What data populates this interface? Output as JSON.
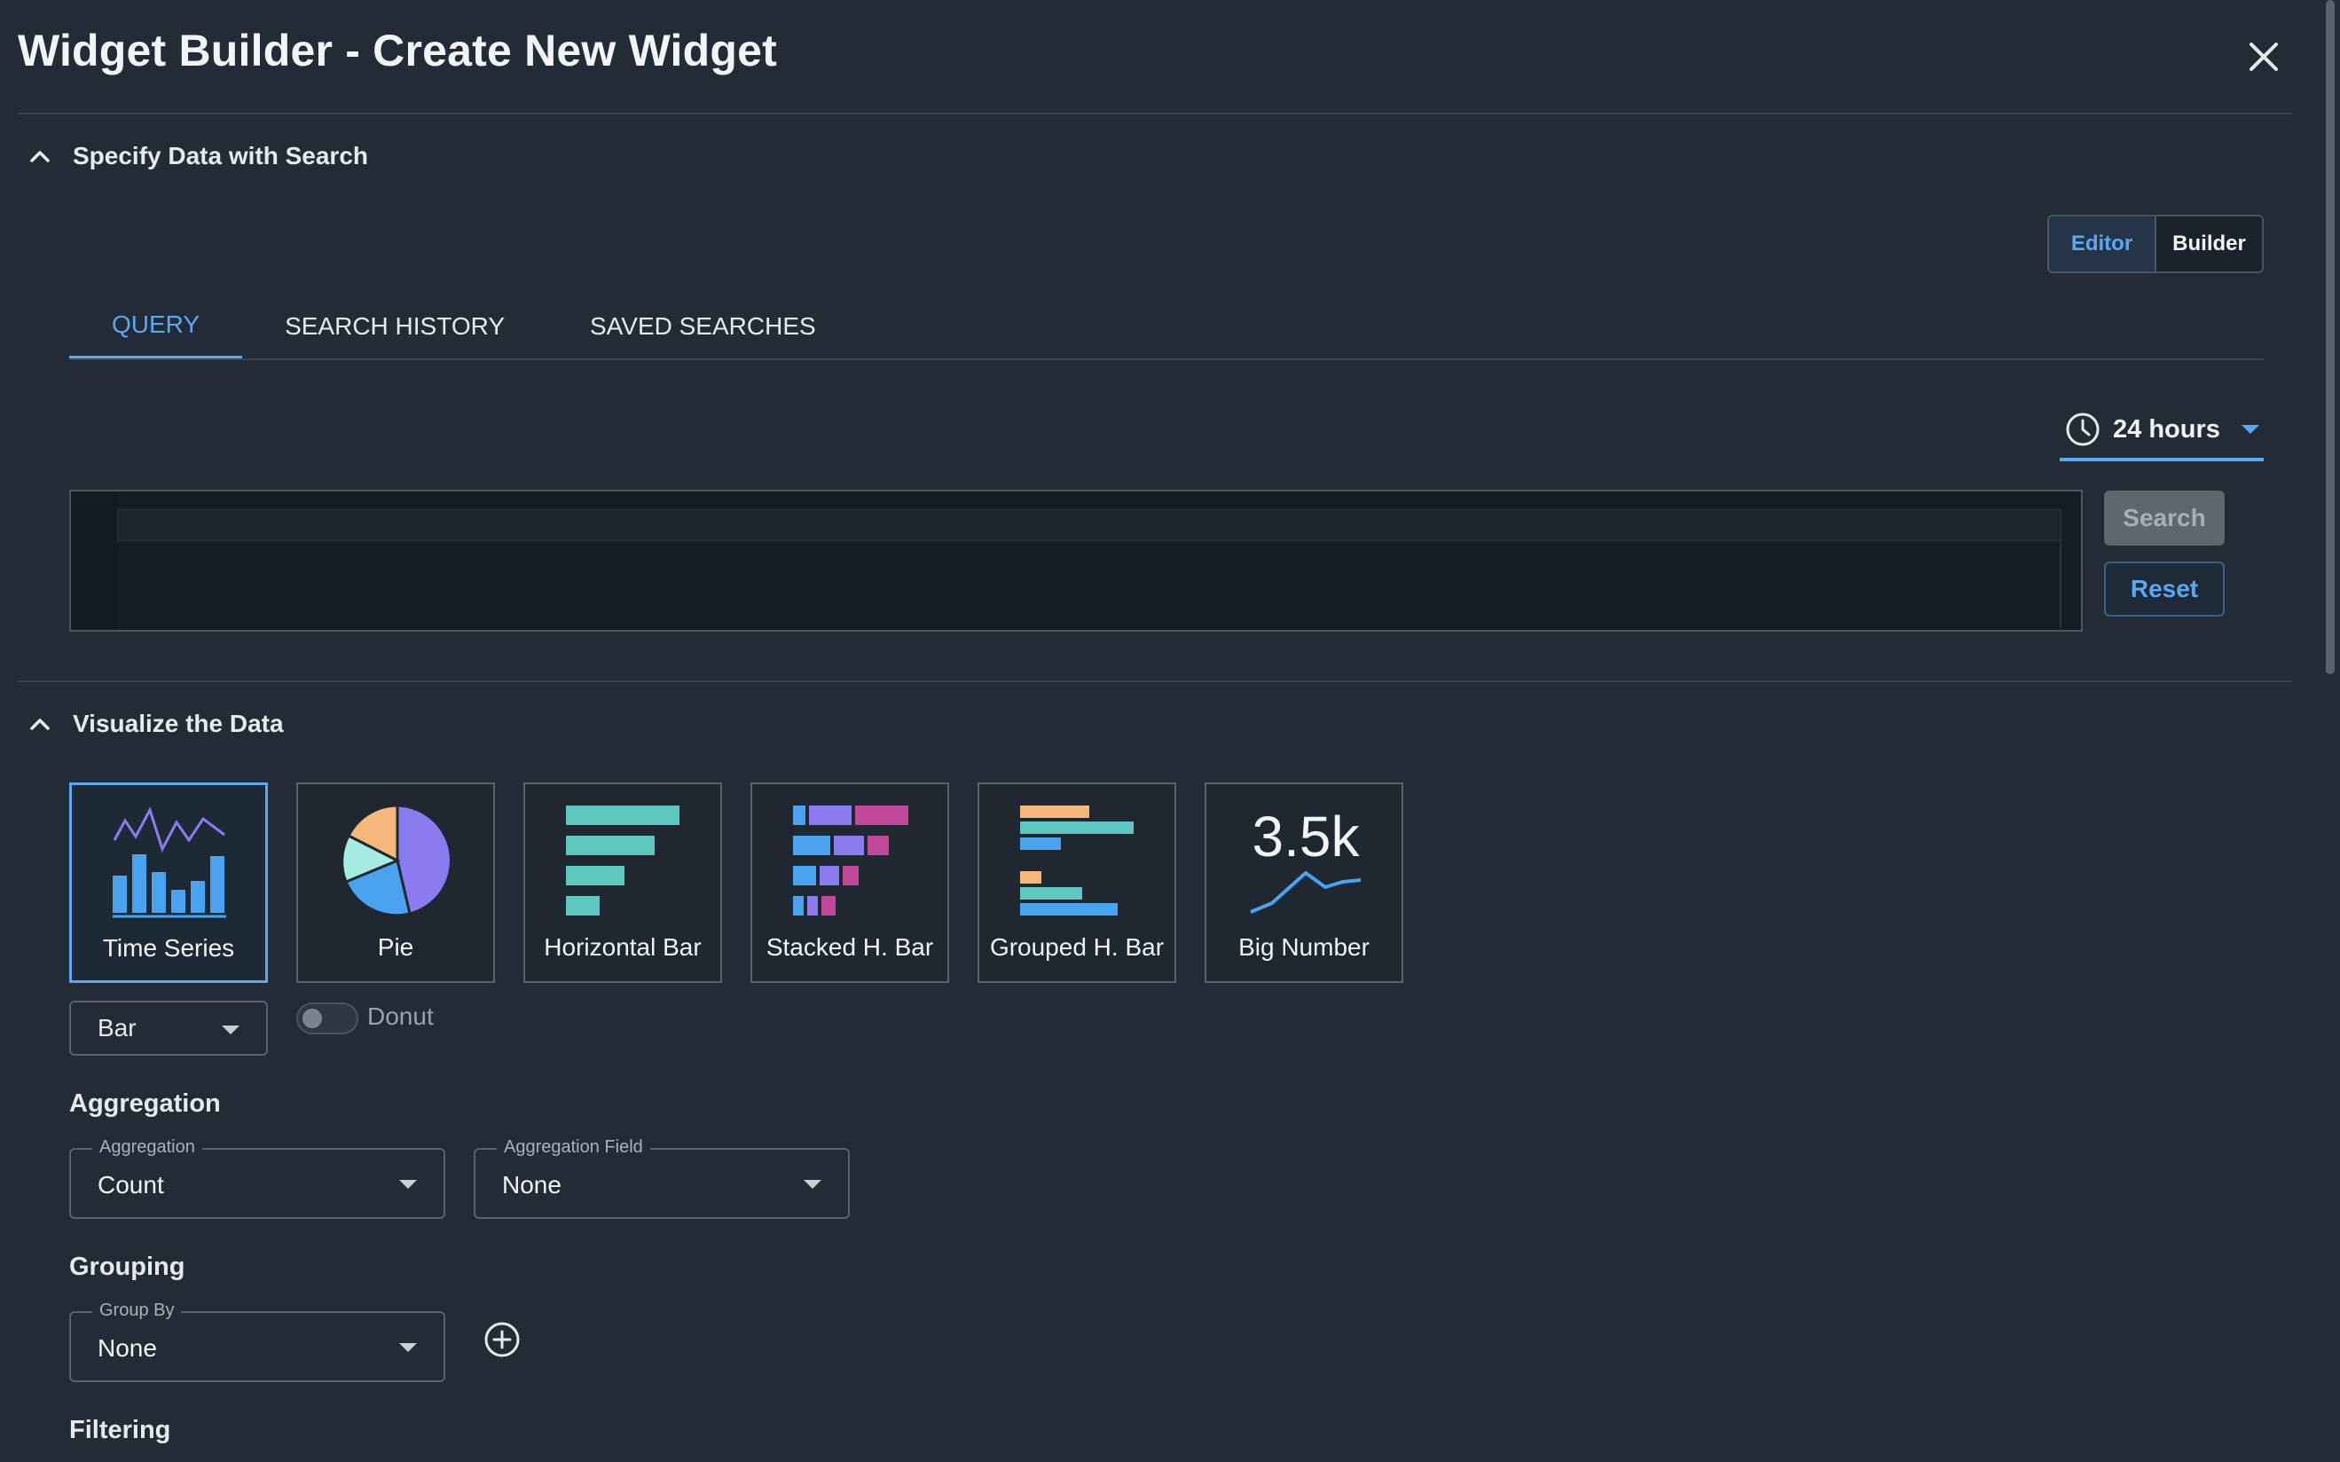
{
  "dialog": {
    "title": "Widget Builder - Create New Widget",
    "close_icon": "close-icon"
  },
  "search_section": {
    "header": "Specify Data with Search",
    "mode_toggle": {
      "editor": "Editor",
      "builder": "Builder",
      "selected": "Editor"
    },
    "tabs": [
      {
        "label": "QUERY",
        "active": true
      },
      {
        "label": "SEARCH HISTORY",
        "active": false
      },
      {
        "label": "SAVED SEARCHES",
        "active": false
      }
    ],
    "time_range": {
      "label": "24 hours",
      "icon": "clock-icon"
    },
    "query_value": "",
    "search_button": "Search",
    "reset_button": "Reset"
  },
  "visualize_section": {
    "header": "Visualize the Data",
    "chart_types": [
      {
        "label": "Time Series",
        "icon": "time-series-chart-icon",
        "selected": true
      },
      {
        "label": "Pie",
        "icon": "pie-chart-icon",
        "selected": false
      },
      {
        "label": "Horizontal Bar",
        "icon": "horizontal-bar-chart-icon",
        "selected": false
      },
      {
        "label": "Stacked H. Bar",
        "icon": "stacked-horizontal-bar-icon",
        "selected": false
      },
      {
        "label": "Grouped H. Bar",
        "icon": "grouped-horizontal-bar-icon",
        "selected": false
      },
      {
        "label": "Big Number",
        "icon": "big-number-icon",
        "selected": false,
        "preview_value": "3.5k"
      }
    ],
    "series_style": {
      "value": "Bar"
    },
    "donut_toggle": {
      "label": "Donut",
      "on": false
    },
    "aggregation": {
      "heading": "Aggregation",
      "aggregation_field": {
        "label": "Aggregation",
        "value": "Count"
      },
      "aggregation_field_select": {
        "label": "Aggregation Field",
        "value": "None"
      }
    },
    "grouping": {
      "heading": "Grouping",
      "group_by": {
        "label": "Group By",
        "value": "None"
      }
    },
    "filtering": {
      "heading": "Filtering"
    }
  },
  "colors": {
    "background": "#222b36",
    "accent": "#5aa7f2",
    "border": "#59626e"
  }
}
